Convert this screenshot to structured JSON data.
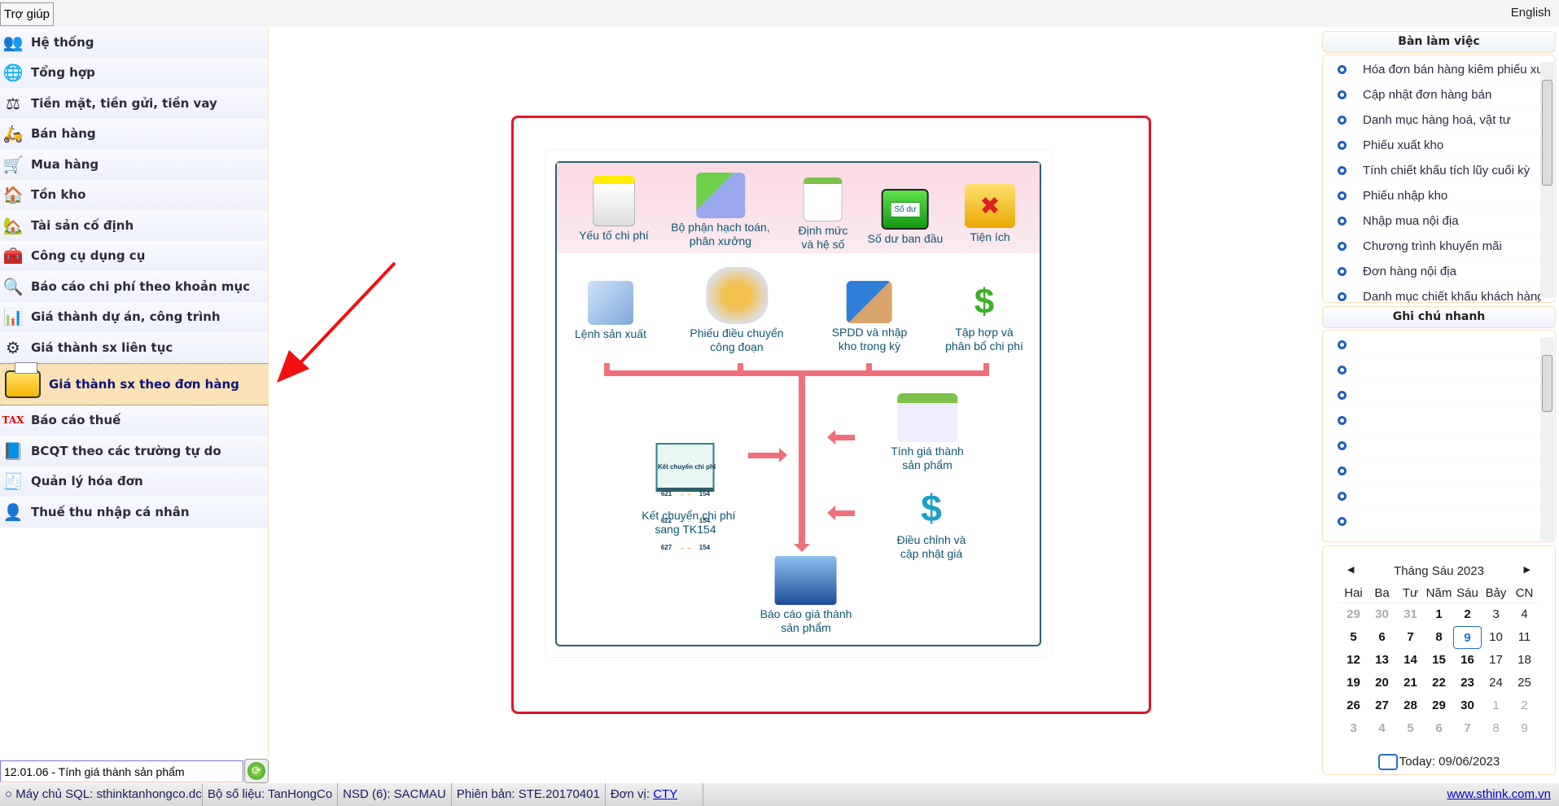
{
  "topbar": {
    "help": "Trợ giúp",
    "language": "English"
  },
  "sidebar": {
    "items": [
      {
        "label": "Hệ thống",
        "icon": "people-gears-icon"
      },
      {
        "label": "Tổng hợp",
        "icon": "puzzle-globe-icon"
      },
      {
        "label": "Tiền mặt, tiền gửi, tiền vay",
        "icon": "scales-icon"
      },
      {
        "label": "Bán hàng",
        "icon": "delivery-icon"
      },
      {
        "label": "Mua hàng",
        "icon": "shopping-cart-icon"
      },
      {
        "label": "Tồn kho",
        "icon": "warehouse-icon"
      },
      {
        "label": "Tài sản cố định",
        "icon": "house-icon"
      },
      {
        "label": "Công cụ dụng cụ",
        "icon": "toolbox-icon"
      },
      {
        "label": "Báo cáo chi phí theo khoản mục",
        "icon": "magnifier-folder-icon"
      },
      {
        "label": "Giá thành dự án, công trình",
        "icon": "bar-chart-icon"
      },
      {
        "label": "Giá thành sx liên tục",
        "icon": "gears-icon"
      },
      {
        "label": "Giá thành sx theo đơn hàng",
        "icon": "folder-icon",
        "selected": true
      },
      {
        "label": "Báo cáo thuế",
        "icon": "tax-icon"
      },
      {
        "label": "BCQT theo các trường tự do",
        "icon": "binder-icon"
      },
      {
        "label": "Quản lý hóa đơn",
        "icon": "invoice-icon"
      },
      {
        "label": "Thuế thu nhập cá nhân",
        "icon": "person-folder-icon"
      }
    ]
  },
  "command": {
    "value": "12.01.06 - Tính giá thành sản phẩm",
    "go_icon": "refresh-icon"
  },
  "diagram": {
    "top_row": [
      "Yếu tố chi phí",
      "Bộ phận hạch toán,\nphân xưởng",
      "Định mức\nvà hệ số",
      "Số dư ban đầu",
      "Tiện ích"
    ],
    "so_du_badge": "Số dư",
    "second_row": [
      "Lệnh sản xuất",
      "Phiếu điều chuyển\ncông đoạn",
      "SPDD và nhập\nkho trong kỳ",
      "Tập hợp và\nphân bổ chi phí"
    ],
    "ket_chuyen": {
      "label": "Kết chuyển chi phí\nsang TK154",
      "card_title": "Kết chuyển chi phí",
      "rows": [
        [
          "621",
          "154"
        ],
        [
          "622",
          "154"
        ],
        [
          "627",
          "154"
        ]
      ]
    },
    "tinh_gia": "Tính giá thành\nsản phẩm",
    "dieu_chinh": "Điều chỉnh và\ncập nhật giá",
    "bao_cao": "Báo cáo giá thành\nsản phẩm",
    "highlight_color": "#e5132a",
    "arrow_color": "#f0707a"
  },
  "desk": {
    "title": "Bàn làm việc",
    "items": [
      "Hóa đơn bán hàng kiêm phiếu xuất kho",
      "Cập nhật đơn hàng bán",
      "Danh mục hàng hoá, vật tư",
      "Phiếu xuất kho",
      "Tính chiết khấu tích lũy cuối kỳ",
      "Phiếu nhập kho",
      "Nhập mua nội địa",
      "Chương trình khuyến mãi",
      "Đơn hàng nội địa",
      "Danh mục chiết khấu khách hàng"
    ]
  },
  "notes": {
    "title": "Ghi chú nhanh",
    "count": 8
  },
  "calendar": {
    "title": "Tháng Sáu 2023",
    "weekdays": [
      "Hai",
      "Ba",
      "Tư",
      "Năm",
      "Sáu",
      "Bảy",
      "CN"
    ],
    "weeks": [
      [
        "29",
        "30",
        "31",
        "1",
        "2",
        "3",
        "4"
      ],
      [
        "5",
        "6",
        "7",
        "8",
        "9",
        "10",
        "11"
      ],
      [
        "12",
        "13",
        "14",
        "15",
        "16",
        "17",
        "18"
      ],
      [
        "19",
        "20",
        "21",
        "22",
        "23",
        "24",
        "25"
      ],
      [
        "26",
        "27",
        "28",
        "29",
        "30",
        "1",
        "2"
      ],
      [
        "3",
        "4",
        "5",
        "6",
        "7",
        "8",
        "9"
      ]
    ],
    "selected": "9",
    "today": "Today: 09/06/2023"
  },
  "status": {
    "sql": "Máy chủ SQL: sthinktanhongco.dc",
    "db": "Bộ số liệu: TanHongCo",
    "user": "NSD (6): SACMAU",
    "version": "Phiên bản: STE.20170401",
    "unit_label": "Đơn vị:",
    "unit": "CTY",
    "site": "www.sthink.com.vn"
  }
}
